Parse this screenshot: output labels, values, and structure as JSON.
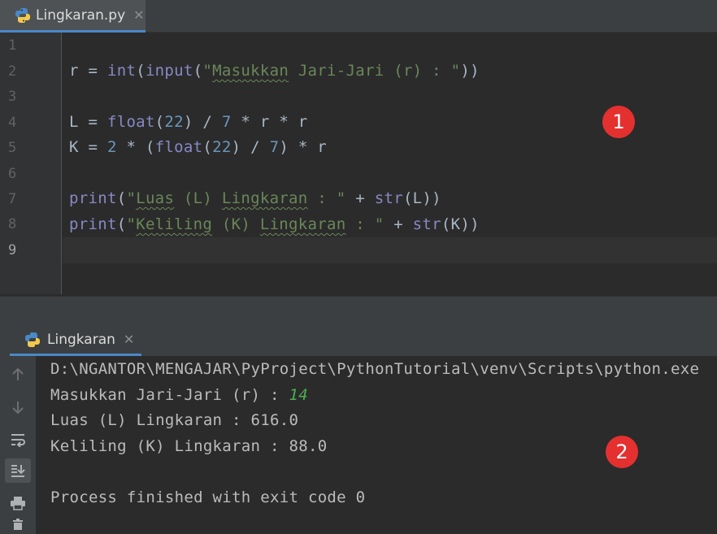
{
  "editor_tab": {
    "filename": "Lingkaran.py",
    "close": "✕"
  },
  "line_numbers": [
    "1",
    "2",
    "3",
    "4",
    "5",
    "6",
    "7",
    "8",
    "9"
  ],
  "code": {
    "line2": {
      "var": "r",
      "eq": " = ",
      "fn1": "int",
      "p1": "(",
      "fn2": "input",
      "p2": "(",
      "q1": "\"",
      "s1": "Masukkan",
      "sp1": " ",
      "s2": "Jari-Jari",
      "s3": " (r) : ",
      "q2": "\"",
      "p3": "))"
    },
    "line4": {
      "a": "L = ",
      "fn": "float",
      "p1": "(",
      "n1": "22",
      "p2": ") / ",
      "n2": "7",
      "rest": " * r * r"
    },
    "line5": {
      "a": "K = ",
      "n1": "2",
      "b": " * (",
      "fn": "float",
      "p1": "(",
      "n2": "22",
      "p2": ") / ",
      "n3": "7",
      "rest": ") * r"
    },
    "line7": {
      "fn": "print",
      "p1": "(",
      "q1": "\"",
      "s1": "Luas",
      "s2": " (L) ",
      "s3": "Lingkaran",
      "s4": " : ",
      "q2": "\"",
      "plus": " + ",
      "fn2": "str",
      "rest": "(L))"
    },
    "line8": {
      "fn": "print",
      "p1": "(",
      "q1": "\"",
      "s1": "Keliling",
      "s2": " (K) ",
      "s3": "Lingkaran",
      "s4": " : ",
      "q2": "\"",
      "plus": " + ",
      "fn2": "str",
      "rest": "(K))"
    }
  },
  "badges": {
    "editor": "1",
    "console": "2"
  },
  "run_tab": {
    "name": "Lingkaran",
    "close": "✕"
  },
  "console": {
    "cmd": "D:\\NGANTOR\\MENGAJAR\\PyProject\\PythonTutorial\\venv\\Scripts\\python.exe",
    "prompt": "Masukkan Jari-Jari (r) : ",
    "input_value": "14",
    "luas": "Luas (L) Lingkaran : 616.0",
    "keliling": "Keliling (K) Lingkaran : 88.0",
    "finished": "Process finished with exit code 0"
  },
  "colors": {
    "accent": "#4a88c7",
    "badge": "#e53030",
    "string": "#6a8759",
    "builtin": "#8888c6",
    "number": "#6897bb"
  }
}
